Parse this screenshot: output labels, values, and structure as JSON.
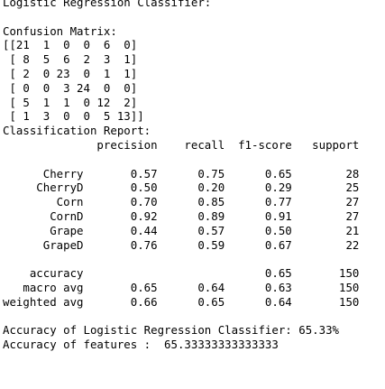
{
  "console": {
    "lines": [
      "Logistic Regression Classifier:",
      "",
      "Confusion Matrix:",
      "[[21  1  0  0  6  0]",
      " [ 8  5  6  2  3  1]",
      " [ 2  0 23  0  1  1]",
      " [ 0  0  3 24  0  0]",
      " [ 5  1  1  0 12  2]",
      " [ 1  3  0  0  5 13]]",
      "Classification Report:",
      "              precision    recall  f1-score   support",
      "",
      "      Cherry       0.57      0.75      0.65        28",
      "     CherryD       0.50      0.20      0.29        25",
      "        Corn       0.70      0.85      0.77        27",
      "       CornD       0.92      0.89      0.91        27",
      "       Grape       0.44      0.57      0.50        21",
      "      GrapeD       0.76      0.59      0.67        22",
      "",
      "    accuracy                           0.65       150",
      "   macro avg       0.65      0.64      0.63       150",
      "weighted avg       0.66      0.65      0.64       150",
      "",
      "Accuracy of Logistic Regression Classifier: 65.33%",
      "Accuracy of features :  65.33333333333333",
      ""
    ]
  }
}
